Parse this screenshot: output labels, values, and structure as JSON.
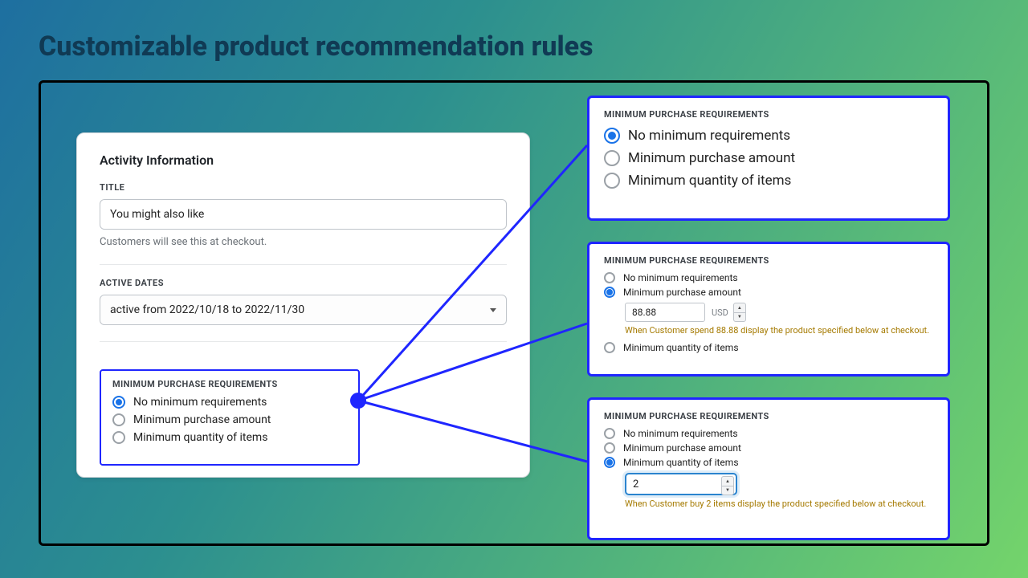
{
  "page_title": "Customizable product recommendation rules",
  "card": {
    "heading": "Activity Information",
    "title_label": "TITLE",
    "title_value": "You might also like",
    "title_helper": "Customers will see this at checkout.",
    "active_dates_label": "ACTIVE DATES",
    "active_dates_value": "active from 2022/10/18 to 2022/11/30"
  },
  "mpr_heading": "MINIMUM PURCHASE REQUIREMENTS",
  "options": {
    "none": "No minimum requirements",
    "amount": "Minimum purchase amount",
    "qty": "Minimum quantity of items"
  },
  "state_amount": {
    "value": "88.88",
    "currency": "USD",
    "hint": "When Customer spend 88.88 display the product specified below at checkout."
  },
  "state_qty": {
    "value": "2",
    "hint": "When Customer buy 2 items display the product specified below at checkout."
  }
}
